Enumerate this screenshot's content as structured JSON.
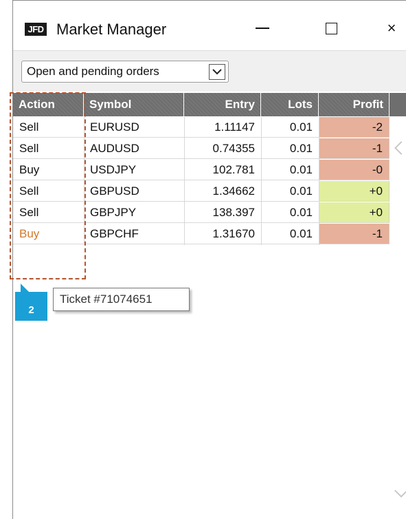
{
  "window": {
    "logo": "JFD",
    "title": "Market Manager",
    "minimize": "minimize",
    "maximize": "maximize",
    "close": "×"
  },
  "toolbar": {
    "filter_value": "Open and pending orders"
  },
  "table": {
    "columns": [
      "Action",
      "Symbol",
      "Entry",
      "Lots",
      "Profit"
    ],
    "rows": [
      {
        "action": "Sell",
        "symbol": "EURUSD",
        "entry": "1.11147",
        "lots": "0.01",
        "profit": "-2",
        "profit_color": "#e6b09a",
        "action_color": "#111111"
      },
      {
        "action": "Sell",
        "symbol": "AUDUSD",
        "entry": "0.74355",
        "lots": "0.01",
        "profit": "-1",
        "profit_color": "#e6b09a",
        "action_color": "#111111"
      },
      {
        "action": "Buy",
        "symbol": "USDJPY",
        "entry": "102.781",
        "lots": "0.01",
        "profit": "-0",
        "profit_color": "#e6b09a",
        "action_color": "#111111"
      },
      {
        "action": "Sell",
        "symbol": "GBPUSD",
        "entry": "1.34662",
        "lots": "0.01",
        "profit": "+0",
        "profit_color": "#e1ee9e",
        "action_color": "#111111"
      },
      {
        "action": "Sell",
        "symbol": "GBPJPY",
        "entry": "138.397",
        "lots": "0.01",
        "profit": "+0",
        "profit_color": "#e1ee9e",
        "action_color": "#111111"
      },
      {
        "action": "Buy",
        "symbol": "GBPCHF",
        "entry": "1.31670",
        "lots": "0.01",
        "profit": "-1",
        "profit_color": "#e6b09a",
        "action_color": "#d07a2c"
      }
    ]
  },
  "annotation": {
    "badge": "2",
    "tooltip": "Ticket #71074651",
    "highlight_color": "#b5542e",
    "badge_color": "#1aa0d6"
  }
}
